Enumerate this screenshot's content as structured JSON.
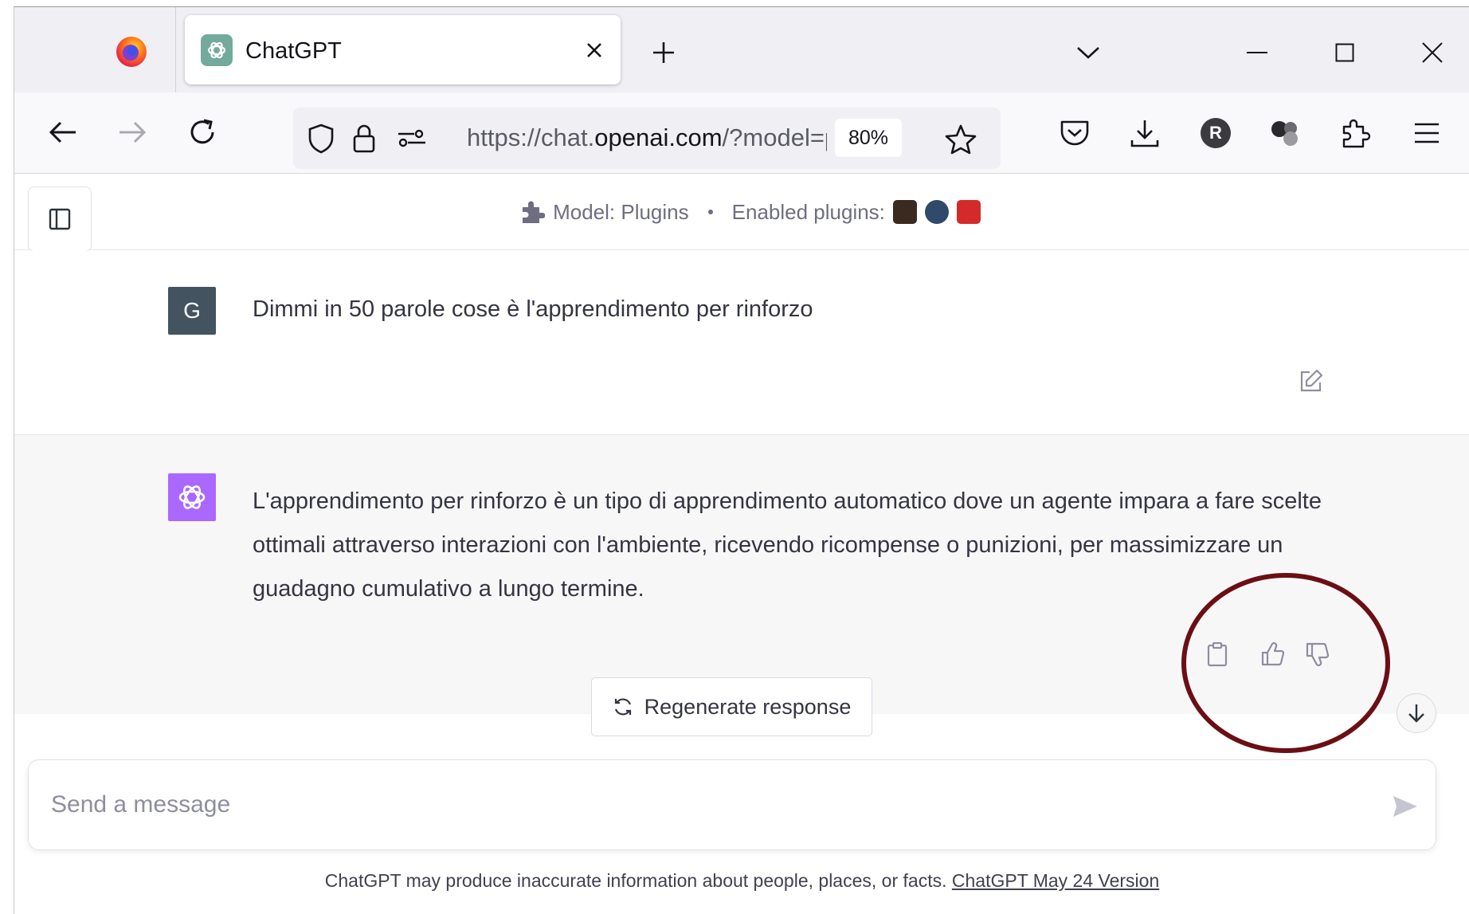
{
  "browser": {
    "tab": {
      "title": "ChatGPT"
    },
    "url": {
      "prefix": "https://chat.",
      "domain": "openai.com",
      "suffix": "/?model=plugins"
    },
    "zoom": "80%",
    "profile_initial": "R"
  },
  "chat": {
    "model_label": "Model: Plugins",
    "enabled_plugins_label": "Enabled plugins:",
    "plugin_colors": [
      "#3b2a20",
      "#2f4a6a",
      "#d32b2b"
    ],
    "user_avatar_initial": "G",
    "user_message": "Dimmi in 50 parole cose è l'apprendimento per rinforzo",
    "assistant_message": "L'apprendimento per rinforzo è un tipo di apprendimento automatico dove un agente impara a fare scelte ottimali attraverso interazioni con l'ambiente, ricevendo ricompense o punizioni, per massimizzare un guadagno cumulativo a lungo termine.",
    "regenerate_label": "Regenerate response",
    "composer_placeholder": "Send a message",
    "disclaimer_text": "ChatGPT may produce inaccurate information about people, places, or facts.",
    "disclaimer_link": "ChatGPT May 24 Version"
  },
  "colors": {
    "assistant_avatar": "#ab68ff",
    "user_avatar": "#435360",
    "annotation_circle": "#6b0f14"
  }
}
